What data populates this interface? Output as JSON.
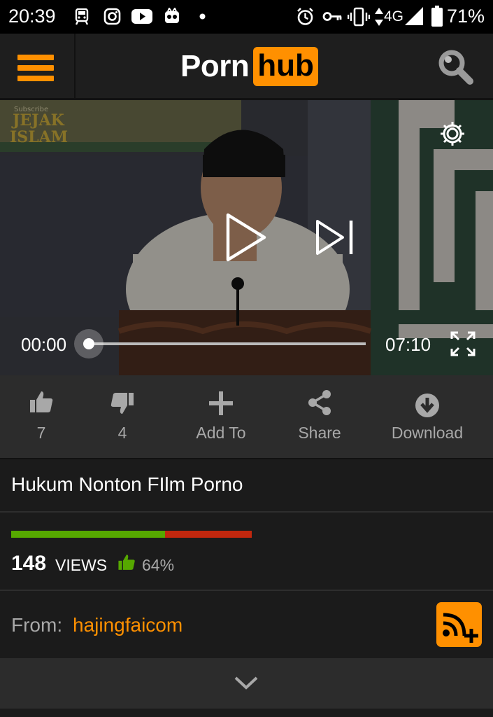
{
  "status_bar": {
    "time": "20:39",
    "network": "4G",
    "battery": "71%",
    "left_icons": [
      "train-icon",
      "instagram-icon",
      "youtube-icon",
      "owl-app-icon",
      "dot-icon"
    ],
    "right_icons": [
      "alarm-icon",
      "key-icon",
      "vibrate-icon",
      "data-arrows-icon",
      "signal-icon",
      "battery-icon"
    ]
  },
  "header": {
    "logo_part1": "Porn",
    "logo_part2": "hub",
    "menu_icon": "hamburger-menu-icon",
    "search_icon": "search-icon",
    "accent": "#ff9000"
  },
  "player": {
    "current_time": "00:00",
    "total_time": "07:10",
    "progress": 0,
    "icons": [
      "settings-icon",
      "play-icon",
      "skip-next-icon",
      "fullscreen-icon"
    ]
  },
  "actions": {
    "like_count": "7",
    "dislike_count": "4",
    "add_to": "Add To",
    "share": "Share",
    "download": "Download"
  },
  "video": {
    "title": "Hukum Nonton FIlm Porno",
    "views_count": "148",
    "views_label": "VIEWS",
    "rating_percent": "64%",
    "rating_fraction": 0.64,
    "colors": {
      "positive": "#56a800",
      "negative": "#c1270e"
    }
  },
  "uploader": {
    "from_label": "From:",
    "name": "hajingfaicom"
  }
}
